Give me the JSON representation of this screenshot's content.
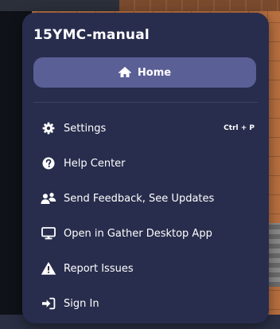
{
  "menu": {
    "title": "15YMC-manual",
    "home_label": "Home",
    "items": [
      {
        "label": "Settings",
        "shortcut": "Ctrl + P",
        "icon": "gear-icon"
      },
      {
        "label": "Help Center",
        "icon": "question-circle-icon"
      },
      {
        "label": "Send Feedback, See Updates",
        "icon": "users-icon"
      },
      {
        "label": "Open in Gather Desktop App",
        "icon": "desktop-icon"
      },
      {
        "label": "Report Issues",
        "icon": "warning-icon"
      },
      {
        "label": "Sign In",
        "icon": "sign-in-icon"
      }
    ]
  },
  "colors": {
    "menu_bg": "#282d4d",
    "home_button_bg": "#5a5f96",
    "text": "#ffffff"
  }
}
